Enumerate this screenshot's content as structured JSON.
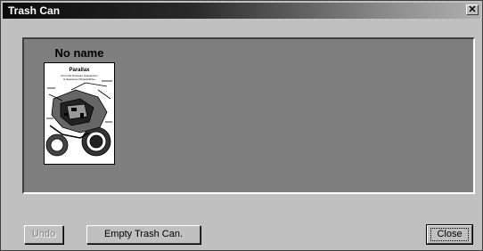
{
  "window": {
    "title": "Trash Can",
    "close_glyph": "✕"
  },
  "items": [
    {
      "label": "No name",
      "thumbnail": "Parallax document preview page"
    }
  ],
  "thumbnail_text": {
    "heading": "Parallax",
    "sub1": "From the Pressure Suspension",
    "sub2": "& Sequence Chassis/Drive"
  },
  "buttons": {
    "undo_label": "Undo",
    "empty_label": "Empty Trash Can.",
    "close_label": "Close"
  },
  "colors": {
    "panel_bg": "#7f7f7f",
    "window_bg": "#c0c0c0"
  }
}
